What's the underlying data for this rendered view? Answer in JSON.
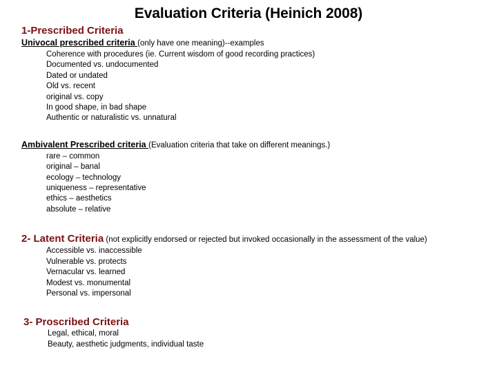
{
  "slide": {
    "title": "Evaluation Criteria (Heinich 2008)",
    "accent_color": "#7B1113",
    "text_color": "#000000",
    "background_color": "#FFFFFF",
    "sections": [
      {
        "heading": "1-Prescribed Criteria",
        "subsections": [
          {
            "label": "Univocal prescribed criteria ",
            "paren": "(only have one meaning)--examples",
            "items": [
              "Coherence with procedures (ie. Current wisdom of good recording practices)",
              "Documented vs. undocumented",
              "Dated or undated",
              "Old vs. recent",
              "original vs. copy",
              "In good shape, in bad shape",
              "Authentic or naturalistic vs. unnatural"
            ]
          },
          {
            "label": "Ambivalent Prescribed criteria ",
            "paren": "(Evaluation criteria that take on different meanings.)",
            "items": [
              "rare – common",
              "original – banal",
              "ecology – technology",
              "uniqueness – representative",
              "ethics – aesthetics",
              "absolute – relative"
            ]
          }
        ]
      },
      {
        "heading": "2- Latent Criteria",
        "heading_paren": " (not explicitly endorsed or rejected but invoked occasionally in the assessment of the value)",
        "items": [
          "Accessible vs. inaccessible",
          "Vulnerable vs. protects",
          "Vernacular vs. learned",
          "Modest vs. monumental",
          "Personal vs. impersonal"
        ]
      },
      {
        "heading": "3- Proscribed Criteria",
        "items": [
          "Legal, ethical, moral",
          "Beauty, aesthetic judgments, individual taste"
        ]
      }
    ]
  }
}
